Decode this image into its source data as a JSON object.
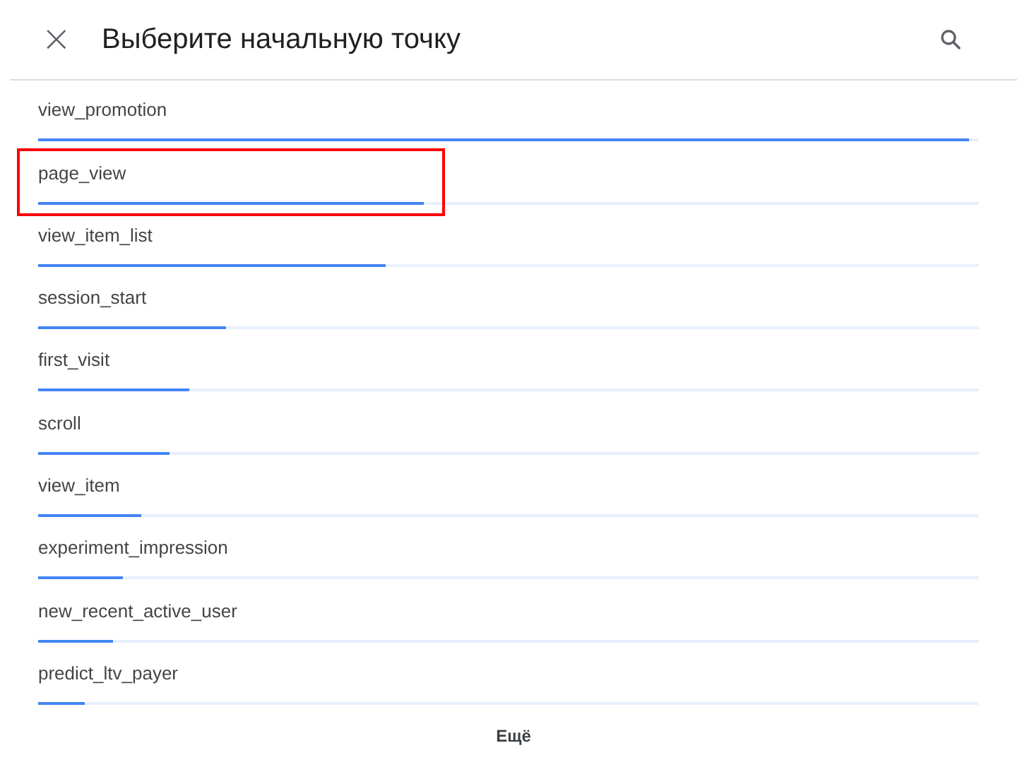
{
  "header": {
    "close": "×",
    "title": "Выберите начальную точку"
  },
  "events": [
    {
      "name": "view_promotion",
      "level": 0.99,
      "highlighted": false
    },
    {
      "name": "page_view",
      "level": 0.41,
      "highlighted": true
    },
    {
      "name": "view_item_list",
      "level": 0.37,
      "highlighted": false
    },
    {
      "name": "session_start",
      "level": 0.2,
      "highlighted": false
    },
    {
      "name": "first_visit",
      "level": 0.16,
      "highlighted": false
    },
    {
      "name": "scroll",
      "level": 0.14,
      "highlighted": false
    },
    {
      "name": "view_item",
      "level": 0.11,
      "highlighted": false
    },
    {
      "name": "experiment_impression",
      "level": 0.09,
      "highlighted": false
    },
    {
      "name": "new_recent_active_user",
      "level": 0.08,
      "highlighted": false
    },
    {
      "name": "predict_ltv_payer",
      "level": 0.05,
      "highlighted": false
    }
  ],
  "more_button": "Ещё"
}
